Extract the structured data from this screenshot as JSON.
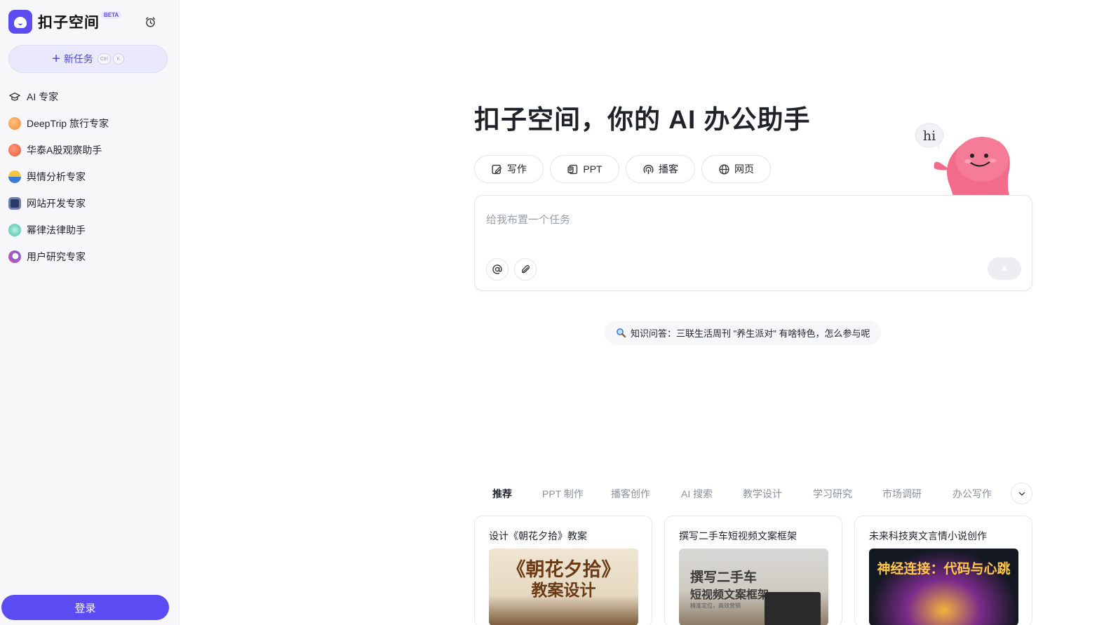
{
  "brand": {
    "name": "扣子空间",
    "badge": "BETA"
  },
  "sidebar": {
    "new_task": {
      "label": "新任务",
      "key1": "Ctrl",
      "key2": "K"
    },
    "items": [
      {
        "label": "AI 专家",
        "icon": "graduation-cap-icon",
        "color": "#ffffff"
      },
      {
        "label": "DeepTrip 旅行专家",
        "icon": "deeptrip-avatar-icon",
        "color": "#f08a3c"
      },
      {
        "label": "华泰A股观察助手",
        "icon": "huatai-avatar-icon",
        "color": "#e8573a"
      },
      {
        "label": "舆情分析专家",
        "icon": "sentiment-avatar-icon",
        "color": "#3a7bd5"
      },
      {
        "label": "网站开发专家",
        "icon": "web-dev-avatar-icon",
        "color": "#2b3a67"
      },
      {
        "label": "幂律法律助手",
        "icon": "law-avatar-icon",
        "color": "#3fbfa8"
      },
      {
        "label": "用户研究专家",
        "icon": "user-research-avatar-icon",
        "color": "#8a5cd6"
      }
    ],
    "login_label": "登录"
  },
  "main": {
    "headline": "扣子空间，你的 AI 办公助手",
    "mascot_greeting": "hi",
    "chips": [
      {
        "label": "写作",
        "icon": "write-icon"
      },
      {
        "label": "PPT",
        "icon": "ppt-icon"
      },
      {
        "label": "播客",
        "icon": "podcast-icon"
      },
      {
        "label": "网页",
        "icon": "globe-icon"
      }
    ],
    "input": {
      "placeholder": "给我布置一个任务"
    },
    "suggestion": "知识问答：三联生活周刊 \"养生派对\" 有啥特色，怎么参与呢",
    "tabs": [
      "推荐",
      "PPT 制作",
      "播客创作",
      "AI 搜索",
      "教学设计",
      "学习研究",
      "市场调研",
      "办公写作"
    ],
    "cards": [
      {
        "title": "设计《朝花夕拾》教案",
        "img_line1": "《朝花夕拾》",
        "img_line2": "教案设计",
        "img_line3": ""
      },
      {
        "title": "撰写二手车短视频文案框架",
        "img_line1": "撰写二手车",
        "img_line2": "短视频文案框架",
        "img_line3": "精准定位，高效营销"
      },
      {
        "title": "未来科技爽文言情小说创作",
        "img_line1": "神经连接：代码与心跳",
        "img_line2": "",
        "img_line3": ""
      }
    ]
  },
  "colors": {
    "accent": "#5a4cf2",
    "sidebar_bg": "#f7f7f9"
  }
}
